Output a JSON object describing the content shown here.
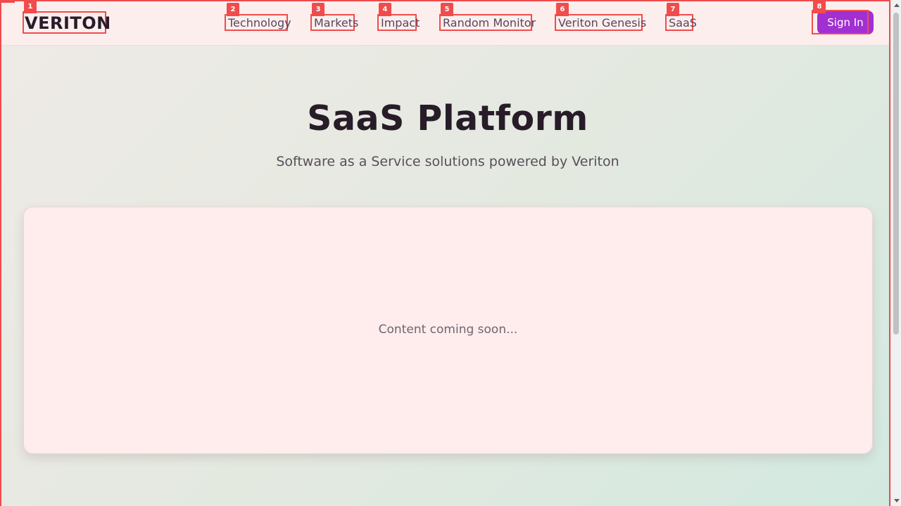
{
  "header": {
    "logo": "VERITON",
    "nav": [
      {
        "label": "Technology",
        "badge": "2"
      },
      {
        "label": "Markets",
        "badge": "3"
      },
      {
        "label": "Impact",
        "badge": "4"
      },
      {
        "label": "Random Monitor",
        "badge": "5"
      },
      {
        "label": "Veriton Genesis",
        "badge": "6"
      },
      {
        "label": "SaaS",
        "badge": "7"
      }
    ],
    "logo_badge": "1",
    "signin_label": "Sign In",
    "signin_badge": "8"
  },
  "hero": {
    "title": "SaaS Platform",
    "subtitle": "Software as a Service solutions powered by Veriton"
  },
  "card": {
    "text": "Content coming soon..."
  },
  "colors": {
    "accent": "#a12fd2",
    "annotation": "#f04c4c",
    "header_bg": "#fdeeee",
    "card_bg": "#ffeded"
  }
}
